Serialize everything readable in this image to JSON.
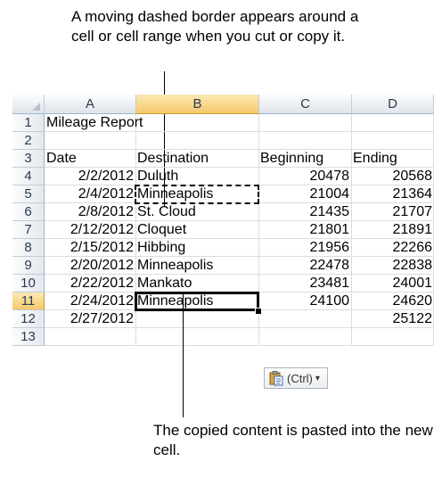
{
  "callouts": {
    "top": "A moving dashed border appears around a cell or cell range when you cut or copy it.",
    "bottom": "The copied content is pasted into the new cell."
  },
  "columns": [
    "A",
    "B",
    "C",
    "D"
  ],
  "rows": [
    "1",
    "2",
    "3",
    "4",
    "5",
    "6",
    "7",
    "8",
    "9",
    "10",
    "11",
    "12",
    "13"
  ],
  "cells": {
    "r1": {
      "a": "Mileage Report"
    },
    "r3": {
      "a": "Date",
      "b": "Destination",
      "c": "Beginning",
      "d": "Ending"
    },
    "r4": {
      "a": "2/2/2012",
      "b": "Duluth",
      "c": "20478",
      "d": "20568"
    },
    "r5": {
      "a": "2/4/2012",
      "b": "Minneapolis",
      "c": "21004",
      "d": "21364"
    },
    "r6": {
      "a": "2/8/2012",
      "b": "St. Cloud",
      "c": "21435",
      "d": "21707"
    },
    "r7": {
      "a": "2/12/2012",
      "b": "Cloquet",
      "c": "21801",
      "d": "21891"
    },
    "r8": {
      "a": "2/15/2012",
      "b": "Hibbing",
      "c": "21956",
      "d": "22266"
    },
    "r9": {
      "a": "2/20/2012",
      "b": "Minneapolis",
      "c": "22478",
      "d": "22838"
    },
    "r10": {
      "a": "2/22/2012",
      "b": "Mankato",
      "c": "23481",
      "d": "24001"
    },
    "r11": {
      "a": "2/24/2012",
      "b": "Minneapolis",
      "c": "24100",
      "d": "24620"
    },
    "r12": {
      "a": "2/27/2012",
      "d": "25122"
    }
  },
  "paste_options": {
    "label": "(Ctrl)",
    "icon": "clipboard-icon"
  },
  "selection": {
    "active_cell": "B11",
    "copied_cell": "B5"
  }
}
